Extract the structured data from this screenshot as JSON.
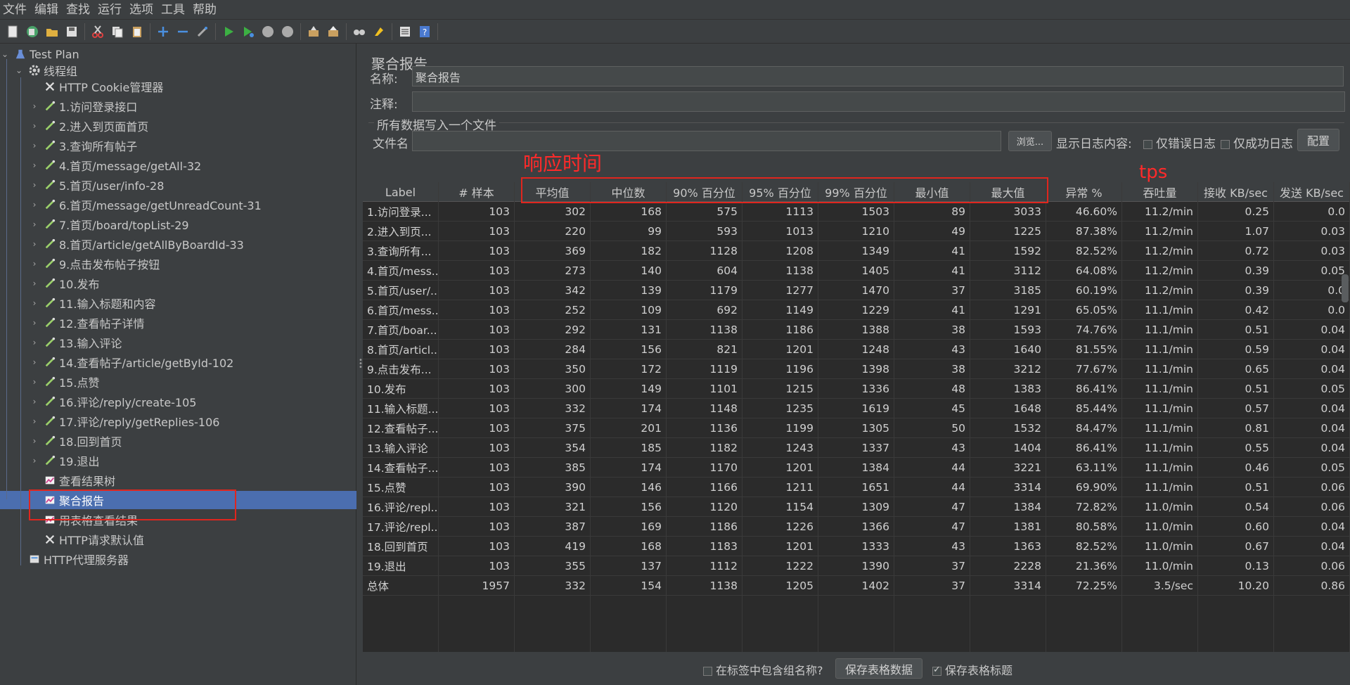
{
  "menu": [
    "文件",
    "编辑",
    "查找",
    "运行",
    "选项",
    "工具",
    "帮助"
  ],
  "toolbar_icons": [
    "new-icon",
    "templates-icon",
    "open-icon",
    "save-icon",
    "cut-icon",
    "copy-icon",
    "paste-icon",
    "expand-icon",
    "collapse-icon",
    "toggle-icon",
    "start-icon",
    "start-no-pause-icon",
    "stop-icon",
    "shutdown-icon",
    "clear-icon",
    "clear-all-icon",
    "search-icon",
    "reset-search-icon",
    "function-helper-icon",
    "help-icon"
  ],
  "tree": {
    "root": "Test Plan",
    "thread_group": "线程组",
    "items": [
      {
        "label": "HTTP Cookie管理器",
        "icon": "config-icon",
        "arrow": false
      },
      {
        "label": "1.访问登录接口",
        "icon": "sampler-icon",
        "arrow": true
      },
      {
        "label": "2.进入到页面首页",
        "icon": "sampler-icon",
        "arrow": true
      },
      {
        "label": "3.查询所有帖子",
        "icon": "sampler-icon",
        "arrow": true
      },
      {
        "label": "4.首页/message/getAll-32",
        "icon": "sampler-icon",
        "arrow": true
      },
      {
        "label": "5.首页/user/info-28",
        "icon": "sampler-icon",
        "arrow": true
      },
      {
        "label": "6.首页/message/getUnreadCount-31",
        "icon": "sampler-icon",
        "arrow": true
      },
      {
        "label": "7.首页/board/topList-29",
        "icon": "sampler-icon",
        "arrow": true
      },
      {
        "label": "8.首页/article/getAllByBoardId-33",
        "icon": "sampler-icon",
        "arrow": true
      },
      {
        "label": "9.点击发布帖子按钮",
        "icon": "sampler-icon",
        "arrow": true
      },
      {
        "label": "10.发布",
        "icon": "sampler-icon",
        "arrow": true
      },
      {
        "label": "11.输入标题和内容",
        "icon": "sampler-icon",
        "arrow": true
      },
      {
        "label": "12.查看帖子详情",
        "icon": "sampler-icon",
        "arrow": true
      },
      {
        "label": "13.输入评论",
        "icon": "sampler-icon",
        "arrow": true
      },
      {
        "label": "14.查看帖子/article/getById-102",
        "icon": "sampler-icon",
        "arrow": true
      },
      {
        "label": "15.点赞",
        "icon": "sampler-icon",
        "arrow": true
      },
      {
        "label": "16.评论/reply/create-105",
        "icon": "sampler-icon",
        "arrow": true
      },
      {
        "label": "17.评论/reply/getReplies-106",
        "icon": "sampler-icon",
        "arrow": true
      },
      {
        "label": "18.回到首页",
        "icon": "sampler-icon",
        "arrow": true
      },
      {
        "label": "19.退出",
        "icon": "sampler-icon",
        "arrow": true
      },
      {
        "label": "查看结果树",
        "icon": "listener-icon",
        "arrow": false
      },
      {
        "label": "聚合报告",
        "icon": "listener-icon",
        "arrow": false,
        "selected": true
      },
      {
        "label": "用表格查看结果",
        "icon": "listener-icon",
        "arrow": false
      },
      {
        "label": "HTTP请求默认值",
        "icon": "config-icon",
        "arrow": false
      }
    ],
    "proxy": "HTTP代理服务器"
  },
  "panel": {
    "title": "聚合报告",
    "name_label": "名称:",
    "name_value": "聚合报告",
    "comment_label": "注释:",
    "comment_value": "",
    "file_section": "所有数据写入一个文件",
    "file_label": "文件名",
    "file_value": "",
    "browse_button": "浏览...",
    "log_label": "显示日志内容:",
    "errors_only": "仅错误日志",
    "success_only": "仅成功日志",
    "config_button": "配置"
  },
  "table": {
    "headers": [
      "Label",
      "# 样本",
      "平均值",
      "中位数",
      "90% 百分位",
      "95% 百分位",
      "99% 百分位",
      "最小值",
      "最大值",
      "异常 %",
      "吞吐量",
      "接收 KB/sec",
      "发送 KB/sec"
    ],
    "rows": [
      [
        "1.访问登录...",
        "103",
        "302",
        "168",
        "575",
        "1113",
        "1503",
        "89",
        "3033",
        "46.60%",
        "11.2/min",
        "0.25",
        "0.0"
      ],
      [
        "2.进入到页...",
        "103",
        "220",
        "99",
        "593",
        "1013",
        "1210",
        "49",
        "1225",
        "87.38%",
        "11.2/min",
        "1.07",
        "0.03"
      ],
      [
        "3.查询所有...",
        "103",
        "369",
        "182",
        "1128",
        "1208",
        "1349",
        "41",
        "1592",
        "82.52%",
        "11.2/min",
        "0.72",
        "0.03"
      ],
      [
        "4.首页/mess...",
        "103",
        "273",
        "140",
        "604",
        "1138",
        "1405",
        "41",
        "3112",
        "64.08%",
        "11.2/min",
        "0.39",
        "0.05"
      ],
      [
        "5.首页/user/...",
        "103",
        "342",
        "139",
        "1179",
        "1277",
        "1470",
        "37",
        "3185",
        "60.19%",
        "11.2/min",
        "0.39",
        "0.0"
      ],
      [
        "6.首页/mess...",
        "103",
        "252",
        "109",
        "692",
        "1149",
        "1229",
        "41",
        "1291",
        "65.05%",
        "11.1/min",
        "0.42",
        "0.0"
      ],
      [
        "7.首页/boar...",
        "103",
        "292",
        "131",
        "1138",
        "1186",
        "1388",
        "38",
        "1593",
        "74.76%",
        "11.1/min",
        "0.51",
        "0.04"
      ],
      [
        "8.首页/articl...",
        "103",
        "284",
        "156",
        "821",
        "1201",
        "1248",
        "43",
        "1640",
        "81.55%",
        "11.1/min",
        "0.59",
        "0.04"
      ],
      [
        "9.点击发布...",
        "103",
        "350",
        "172",
        "1119",
        "1196",
        "1398",
        "38",
        "3212",
        "77.67%",
        "11.1/min",
        "0.65",
        "0.04"
      ],
      [
        "10.发布",
        "103",
        "300",
        "149",
        "1101",
        "1215",
        "1336",
        "48",
        "1383",
        "86.41%",
        "11.1/min",
        "0.51",
        "0.05"
      ],
      [
        "11.输入标题...",
        "103",
        "332",
        "174",
        "1148",
        "1235",
        "1619",
        "45",
        "1648",
        "85.44%",
        "11.1/min",
        "0.57",
        "0.04"
      ],
      [
        "12.查看帖子...",
        "103",
        "375",
        "201",
        "1136",
        "1199",
        "1305",
        "50",
        "1532",
        "84.47%",
        "11.1/min",
        "0.81",
        "0.04"
      ],
      [
        "13.输入评论",
        "103",
        "354",
        "185",
        "1182",
        "1243",
        "1337",
        "43",
        "1404",
        "86.41%",
        "11.1/min",
        "0.55",
        "0.04"
      ],
      [
        "14.查看帖子...",
        "103",
        "385",
        "174",
        "1170",
        "1201",
        "1384",
        "44",
        "3221",
        "63.11%",
        "11.1/min",
        "0.46",
        "0.05"
      ],
      [
        "15.点赞",
        "103",
        "390",
        "146",
        "1166",
        "1211",
        "1651",
        "44",
        "3314",
        "69.90%",
        "11.1/min",
        "0.51",
        "0.06"
      ],
      [
        "16.评论/repl...",
        "103",
        "321",
        "156",
        "1120",
        "1154",
        "1309",
        "47",
        "1384",
        "72.82%",
        "11.0/min",
        "0.54",
        "0.06"
      ],
      [
        "17.评论/repl...",
        "103",
        "387",
        "169",
        "1186",
        "1226",
        "1366",
        "47",
        "1381",
        "80.58%",
        "11.0/min",
        "0.60",
        "0.04"
      ],
      [
        "18.回到首页",
        "103",
        "419",
        "168",
        "1183",
        "1201",
        "1333",
        "43",
        "1363",
        "82.52%",
        "11.0/min",
        "0.67",
        "0.04"
      ],
      [
        "19.退出",
        "103",
        "355",
        "137",
        "1112",
        "1222",
        "1390",
        "37",
        "2228",
        "21.36%",
        "11.0/min",
        "0.13",
        "0.06"
      ],
      [
        "总体",
        "1957",
        "332",
        "154",
        "1138",
        "1205",
        "1402",
        "37",
        "3314",
        "72.25%",
        "3.5/sec",
        "10.20",
        "0.86"
      ]
    ]
  },
  "bottom": {
    "include_group": "在标签中包含组名称?",
    "save_data": "保存表格数据",
    "save_header": "保存表格标题"
  },
  "annotations": {
    "response_time": "响应时间",
    "tps": "tps"
  },
  "colors": {
    "annotation": "#e0261e",
    "selection": "#4b6eaf"
  }
}
